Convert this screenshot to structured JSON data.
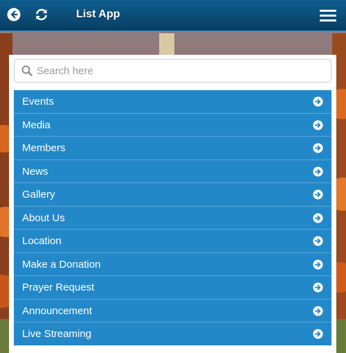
{
  "header": {
    "title": "List App",
    "back_icon": "back-arrow-circle-icon",
    "refresh_icon": "refresh-icon",
    "menu_icon": "hamburger-menu-icon"
  },
  "search": {
    "placeholder": "Search here",
    "value": ""
  },
  "menu": {
    "items": [
      {
        "label": "Events"
      },
      {
        "label": "Media"
      },
      {
        "label": "Members"
      },
      {
        "label": "News"
      },
      {
        "label": "Gallery"
      },
      {
        "label": "About Us"
      },
      {
        "label": "Location"
      },
      {
        "label": "Make a Donation"
      },
      {
        "label": "Prayer Request"
      },
      {
        "label": "Announcement"
      },
      {
        "label": "Live Streaming"
      }
    ]
  },
  "colors": {
    "header_top": "#0f5f8f",
    "header_bottom": "#083e63",
    "item_bg": "#2388c8",
    "item_divider": "#5aa9dd"
  }
}
